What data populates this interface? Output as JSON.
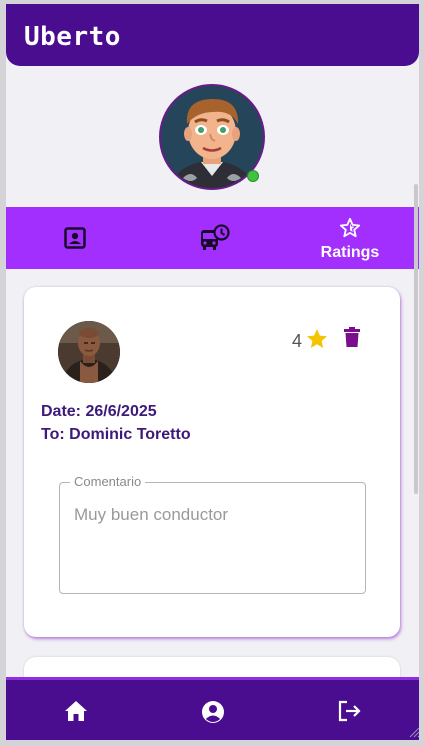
{
  "app": {
    "title": "Uberto"
  },
  "profile": {
    "avatar_icon": "user-avatar",
    "status": "online",
    "status_color": "#3fc33f"
  },
  "tabs": [
    {
      "icon": "profile-card-icon",
      "label": ""
    },
    {
      "icon": "bus-clock-icon",
      "label": ""
    },
    {
      "icon": "star-outline-icon",
      "label": "Ratings",
      "active": true
    }
  ],
  "ratings": [
    {
      "driver_photo": "driver-avatar",
      "stars": "4",
      "date": "Date: 26/6/2025",
      "to": "To: Dominic Toretto",
      "comment_label": "Comentario",
      "comment_value": "Muy buen conductor"
    }
  ],
  "bottom_nav": [
    {
      "icon": "home-icon"
    },
    {
      "icon": "account-circle-icon"
    },
    {
      "icon": "logout-icon"
    }
  ],
  "colors": {
    "primary": "#4b0d8f",
    "accent": "#a32fff",
    "star": "#f5c400",
    "delete": "#7a0e8c",
    "text_dark": "#3d1a7a"
  }
}
